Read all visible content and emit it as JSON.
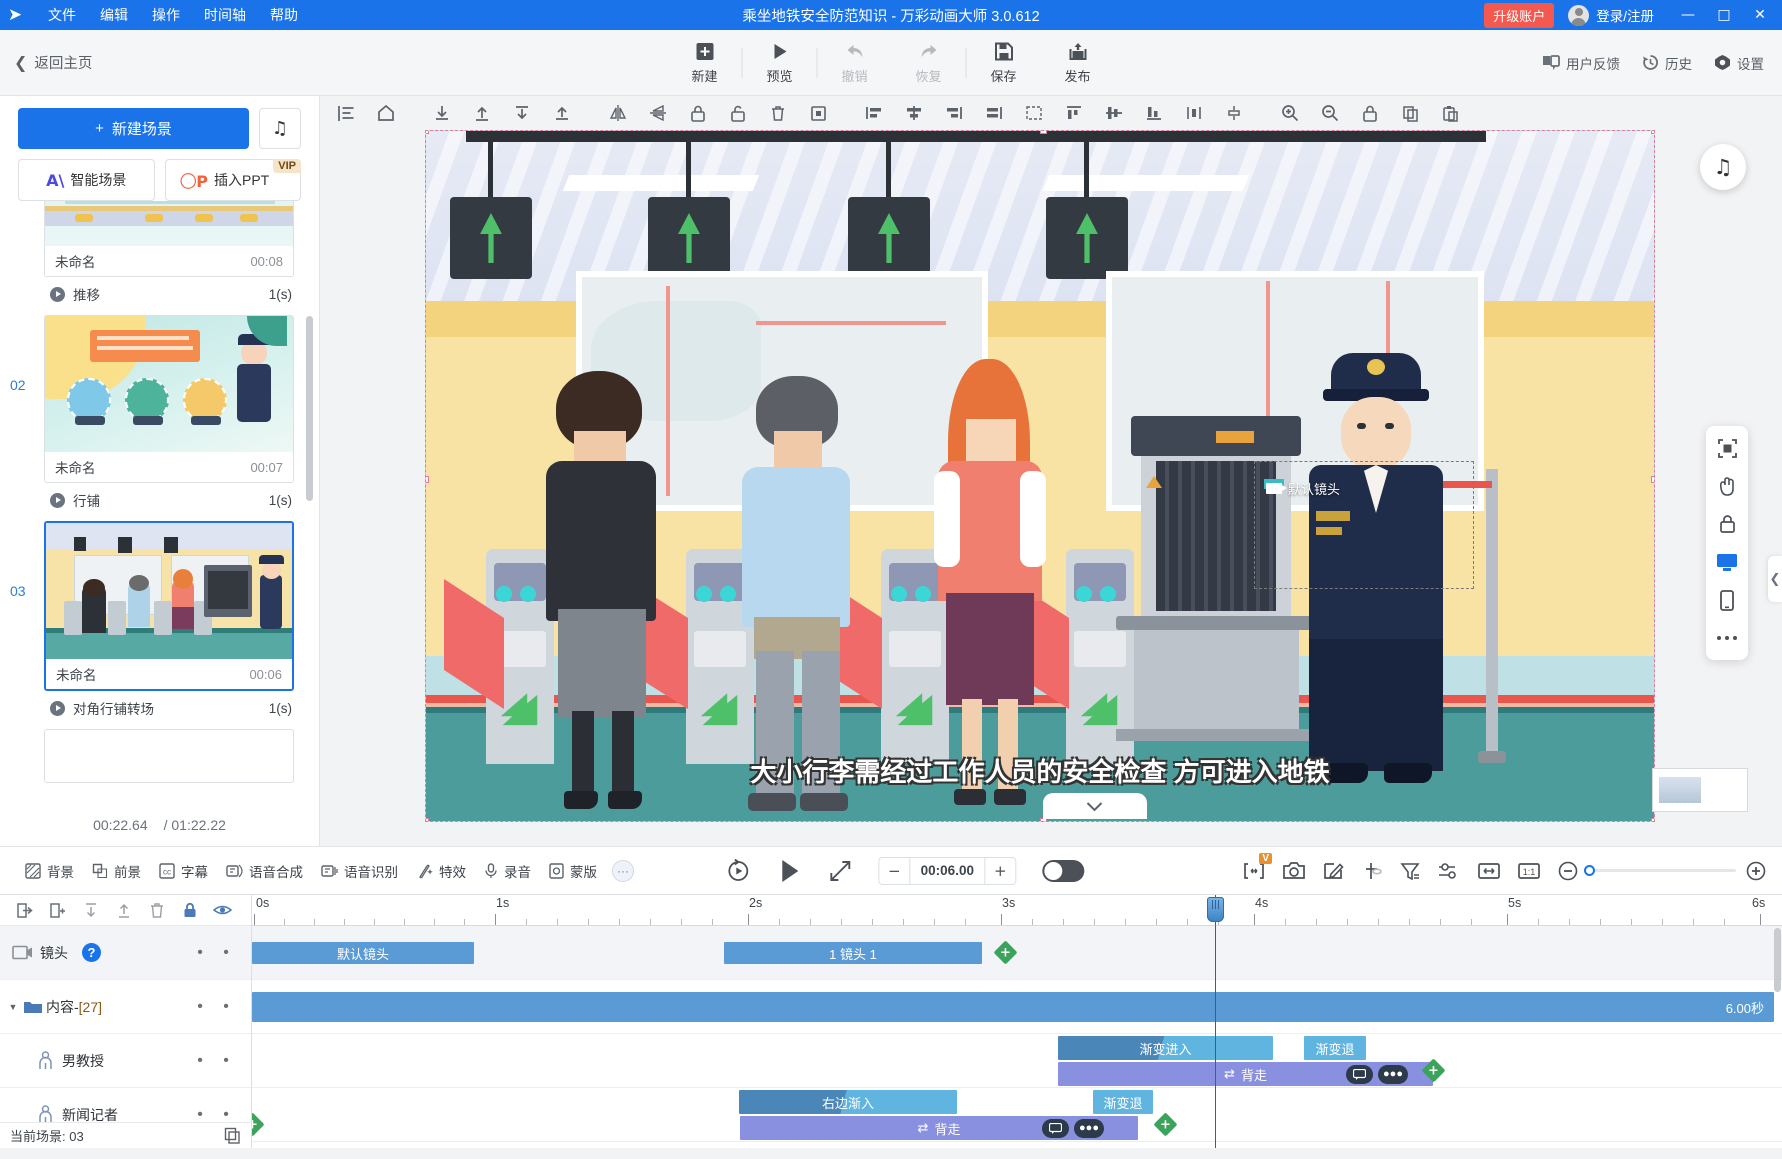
{
  "titlebar": {
    "menus": [
      "文件",
      "编辑",
      "操作",
      "时间轴",
      "帮助"
    ],
    "title": "乘坐地铁安全防范知识 - 万彩动画大师 3.0.612",
    "upgrade_label": "升级账户",
    "account_label": "登录/注册",
    "window_minimize": "—",
    "window_maximize": "□",
    "window_close": "✕"
  },
  "toolbar": {
    "back_home": "返回主页",
    "actions": [
      {
        "label": "新建",
        "icon": "plus-square-icon",
        "disabled": false
      },
      {
        "label": "预览",
        "icon": "play-icon",
        "disabled": false
      },
      {
        "label": "撤销",
        "icon": "undo-icon",
        "disabled": true
      },
      {
        "label": "恢复",
        "icon": "redo-icon",
        "disabled": true
      },
      {
        "label": "保存",
        "icon": "save-icon",
        "disabled": false
      },
      {
        "label": "发布",
        "icon": "publish-icon",
        "disabled": false
      }
    ],
    "right_items": [
      {
        "label": "用户反馈",
        "icon": "feedback-icon"
      },
      {
        "label": "历史",
        "icon": "history-icon"
      },
      {
        "label": "设置",
        "icon": "gear-icon"
      }
    ]
  },
  "sidebar": {
    "new_scene_label": "新建场景",
    "smart_scene_label": "智能场景",
    "insert_ppt_label": "插入PPT",
    "vip_tag": "VIP",
    "scenes": [
      {
        "number": "",
        "name": "未命名",
        "duration": "00:08",
        "transition": "推移",
        "transition_duration": "1(s)",
        "selected": false
      },
      {
        "number": "02",
        "name": "未命名",
        "duration": "00:07",
        "transition": "行铺",
        "transition_duration": "1(s)",
        "selected": false
      },
      {
        "number": "03",
        "name": "未命名",
        "duration": "00:06",
        "transition": "对角行铺转场",
        "transition_duration": "1(s)",
        "selected": true
      }
    ],
    "current_time": "00:22.64",
    "total_time": "/ 01:22.22"
  },
  "canvas": {
    "camera_label": "默认镜头",
    "subtitle": "大小行李需经过工作人员的安全检查 方可进入地铁"
  },
  "playbar": {
    "tools": [
      {
        "label": "背景",
        "icon": "background-icon"
      },
      {
        "label": "前景",
        "icon": "foreground-icon"
      },
      {
        "label": "字幕",
        "icon": "subtitle-icon"
      },
      {
        "label": "语音合成",
        "icon": "tts-icon"
      },
      {
        "label": "语音识别",
        "icon": "asr-icon"
      },
      {
        "label": "特效",
        "icon": "effects-icon"
      },
      {
        "label": "录音",
        "icon": "microphone-icon"
      },
      {
        "label": "蒙版",
        "icon": "mask-icon"
      }
    ],
    "more_label": "···",
    "duration_value": "00:06.00",
    "minus_label": "−",
    "plus_label": "+",
    "vip_badge": "V",
    "right_icons": [
      "fit-width-icon",
      "camera-snapshot-icon",
      "edit-icon",
      "pin-icon",
      "filter-icon",
      "settings-sliders-icon",
      "expand-horizontal-icon",
      "ratio-1-1-icon"
    ],
    "zoom_out_label": "−",
    "zoom_in_label": "+"
  },
  "timeline": {
    "tools": [
      "import-icon",
      "new-folder-icon",
      "move-down-icon",
      "move-up-icon",
      "delete-icon",
      "lock-icon",
      "eye-icon"
    ],
    "tracks": [
      {
        "name": "镜头",
        "icon": "camera-track-icon",
        "selected": true,
        "has_help": true,
        "help": "?"
      },
      {
        "name": "内容-",
        "count": "[27]",
        "icon": "folder-icon",
        "selected": false,
        "expanded": true
      },
      {
        "name": "男教授",
        "icon": "person-icon",
        "selected": false
      },
      {
        "name": "新闻记者",
        "icon": "person-icon",
        "selected": false
      }
    ],
    "ruler_labels": [
      "0s",
      "1s",
      "2s",
      "3s",
      "4s",
      "5s",
      "6s"
    ],
    "camera_clips": [
      {
        "label": "默认镜头",
        "start_pct": 0,
        "width_pct": 14.2
      },
      {
        "label": "1 镜头 1",
        "start_pct": 34.2,
        "width_pct": 16.6
      }
    ],
    "content_clip": {
      "label": "6.00秒",
      "start_pct": 0,
      "width_pct": 100
    },
    "professor_clips": [
      {
        "type": "anim-in",
        "label": "渐变进入",
        "start_pct": 52.7,
        "width_pct": 14.1
      },
      {
        "type": "anim-out",
        "label": "渐变退",
        "start_pct": 68.8,
        "width_pct": 4.1
      },
      {
        "type": "motion",
        "label": "背走",
        "start_pct": 52.7,
        "width_pct": 24.5
      }
    ],
    "reporter_clips": [
      {
        "type": "anim-in",
        "label": "右边渐入",
        "start_pct": 31.8,
        "width_pct": 14.3
      },
      {
        "type": "anim-out",
        "label": "渐变退",
        "start_pct": 55.6,
        "width_pct": 4.0
      },
      {
        "type": "motion",
        "label": "背走",
        "start_pct": 31.9,
        "width_pct": 26.0
      }
    ],
    "status": "当前场景: 03"
  }
}
